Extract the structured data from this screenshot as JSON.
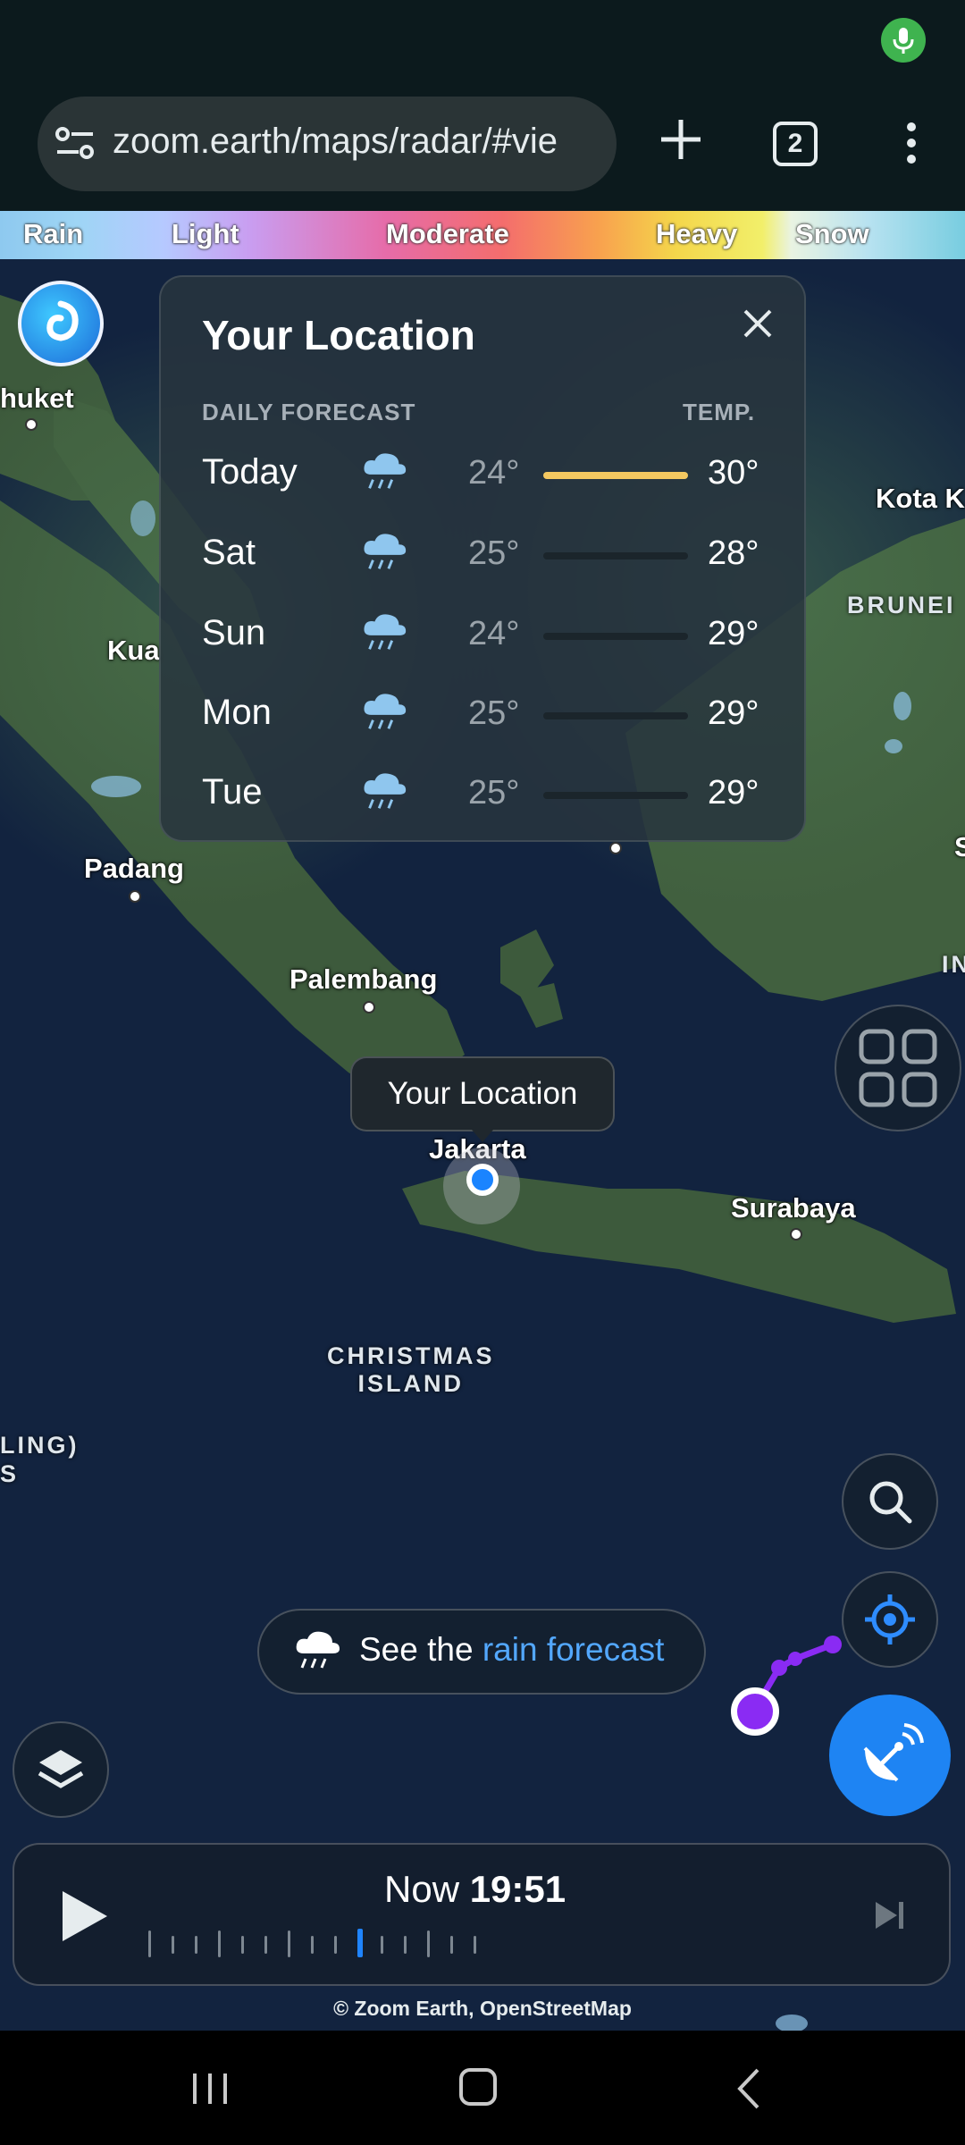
{
  "browser": {
    "url": "zoom.earth/maps/radar/#vie",
    "tab_count": "2",
    "icons": [
      "mic-icon",
      "site-settings-icon",
      "new-tab-plus-icon",
      "tab-switcher-icon",
      "more-menu-icon"
    ]
  },
  "legend": {
    "labels": [
      "Rain",
      "Light",
      "Moderate",
      "Heavy",
      "Snow"
    ]
  },
  "forecast_card": {
    "title": "Your Location",
    "header_left": "DAILY FORECAST",
    "header_right": "TEMP.",
    "days": [
      {
        "day": "Today",
        "low": "24°",
        "high": "30°",
        "icon": "rain-cloud-icon",
        "highlight": true
      },
      {
        "day": "Sat",
        "low": "25°",
        "high": "28°",
        "icon": "rain-cloud-icon",
        "highlight": false
      },
      {
        "day": "Sun",
        "low": "24°",
        "high": "29°",
        "icon": "rain-cloud-icon",
        "highlight": false
      },
      {
        "day": "Mon",
        "low": "25°",
        "high": "29°",
        "icon": "rain-cloud-icon",
        "highlight": false
      },
      {
        "day": "Tue",
        "low": "25°",
        "high": "29°",
        "icon": "rain-cloud-icon",
        "highlight": false
      }
    ]
  },
  "map": {
    "cities": {
      "phuket": "huket",
      "kuala": "Kua",
      "padang": "Padang",
      "palembang": "Palembang",
      "jakarta": "Jakarta",
      "surabaya": "Surabaya",
      "kota": "Kota K",
      "brunei": "BRUNEI",
      "christmas_island": "CHRISTMAS\nISLAND",
      "cocos": "LING)",
      "cocos2": "S",
      "edge_s": "S",
      "edge_in": "IN"
    },
    "location_tooltip": "Your Location"
  },
  "rain_pill": {
    "prefix": "See the ",
    "link": "rain forecast"
  },
  "timeline": {
    "now_label": "Now",
    "time": "19:51"
  },
  "attribution": "© Zoom Earth, OpenStreetMap",
  "colors": {
    "accent_blue": "#1e84f3",
    "storm_purple": "#8a2bf3",
    "today_bar": "#f4c860",
    "land": "#3d5a3c",
    "ocean": "#12233f"
  }
}
